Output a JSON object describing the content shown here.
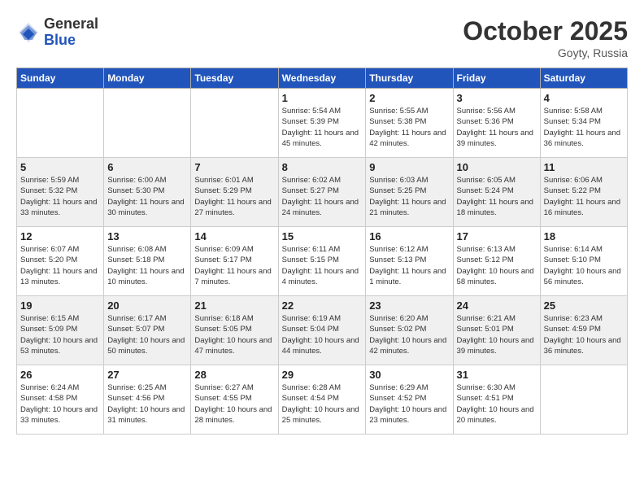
{
  "header": {
    "logo_general": "General",
    "logo_blue": "Blue",
    "month_title": "October 2025",
    "location": "Goyty, Russia"
  },
  "days_of_week": [
    "Sunday",
    "Monday",
    "Tuesday",
    "Wednesday",
    "Thursday",
    "Friday",
    "Saturday"
  ],
  "weeks": [
    [
      {
        "day": "",
        "info": ""
      },
      {
        "day": "",
        "info": ""
      },
      {
        "day": "",
        "info": ""
      },
      {
        "day": "1",
        "info": "Sunrise: 5:54 AM\nSunset: 5:39 PM\nDaylight: 11 hours and 45 minutes."
      },
      {
        "day": "2",
        "info": "Sunrise: 5:55 AM\nSunset: 5:38 PM\nDaylight: 11 hours and 42 minutes."
      },
      {
        "day": "3",
        "info": "Sunrise: 5:56 AM\nSunset: 5:36 PM\nDaylight: 11 hours and 39 minutes."
      },
      {
        "day": "4",
        "info": "Sunrise: 5:58 AM\nSunset: 5:34 PM\nDaylight: 11 hours and 36 minutes."
      }
    ],
    [
      {
        "day": "5",
        "info": "Sunrise: 5:59 AM\nSunset: 5:32 PM\nDaylight: 11 hours and 33 minutes."
      },
      {
        "day": "6",
        "info": "Sunrise: 6:00 AM\nSunset: 5:30 PM\nDaylight: 11 hours and 30 minutes."
      },
      {
        "day": "7",
        "info": "Sunrise: 6:01 AM\nSunset: 5:29 PM\nDaylight: 11 hours and 27 minutes."
      },
      {
        "day": "8",
        "info": "Sunrise: 6:02 AM\nSunset: 5:27 PM\nDaylight: 11 hours and 24 minutes."
      },
      {
        "day": "9",
        "info": "Sunrise: 6:03 AM\nSunset: 5:25 PM\nDaylight: 11 hours and 21 minutes."
      },
      {
        "day": "10",
        "info": "Sunrise: 6:05 AM\nSunset: 5:24 PM\nDaylight: 11 hours and 18 minutes."
      },
      {
        "day": "11",
        "info": "Sunrise: 6:06 AM\nSunset: 5:22 PM\nDaylight: 11 hours and 16 minutes."
      }
    ],
    [
      {
        "day": "12",
        "info": "Sunrise: 6:07 AM\nSunset: 5:20 PM\nDaylight: 11 hours and 13 minutes."
      },
      {
        "day": "13",
        "info": "Sunrise: 6:08 AM\nSunset: 5:18 PM\nDaylight: 11 hours and 10 minutes."
      },
      {
        "day": "14",
        "info": "Sunrise: 6:09 AM\nSunset: 5:17 PM\nDaylight: 11 hours and 7 minutes."
      },
      {
        "day": "15",
        "info": "Sunrise: 6:11 AM\nSunset: 5:15 PM\nDaylight: 11 hours and 4 minutes."
      },
      {
        "day": "16",
        "info": "Sunrise: 6:12 AM\nSunset: 5:13 PM\nDaylight: 11 hours and 1 minute."
      },
      {
        "day": "17",
        "info": "Sunrise: 6:13 AM\nSunset: 5:12 PM\nDaylight: 10 hours and 58 minutes."
      },
      {
        "day": "18",
        "info": "Sunrise: 6:14 AM\nSunset: 5:10 PM\nDaylight: 10 hours and 56 minutes."
      }
    ],
    [
      {
        "day": "19",
        "info": "Sunrise: 6:15 AM\nSunset: 5:09 PM\nDaylight: 10 hours and 53 minutes."
      },
      {
        "day": "20",
        "info": "Sunrise: 6:17 AM\nSunset: 5:07 PM\nDaylight: 10 hours and 50 minutes."
      },
      {
        "day": "21",
        "info": "Sunrise: 6:18 AM\nSunset: 5:05 PM\nDaylight: 10 hours and 47 minutes."
      },
      {
        "day": "22",
        "info": "Sunrise: 6:19 AM\nSunset: 5:04 PM\nDaylight: 10 hours and 44 minutes."
      },
      {
        "day": "23",
        "info": "Sunrise: 6:20 AM\nSunset: 5:02 PM\nDaylight: 10 hours and 42 minutes."
      },
      {
        "day": "24",
        "info": "Sunrise: 6:21 AM\nSunset: 5:01 PM\nDaylight: 10 hours and 39 minutes."
      },
      {
        "day": "25",
        "info": "Sunrise: 6:23 AM\nSunset: 4:59 PM\nDaylight: 10 hours and 36 minutes."
      }
    ],
    [
      {
        "day": "26",
        "info": "Sunrise: 6:24 AM\nSunset: 4:58 PM\nDaylight: 10 hours and 33 minutes."
      },
      {
        "day": "27",
        "info": "Sunrise: 6:25 AM\nSunset: 4:56 PM\nDaylight: 10 hours and 31 minutes."
      },
      {
        "day": "28",
        "info": "Sunrise: 6:27 AM\nSunset: 4:55 PM\nDaylight: 10 hours and 28 minutes."
      },
      {
        "day": "29",
        "info": "Sunrise: 6:28 AM\nSunset: 4:54 PM\nDaylight: 10 hours and 25 minutes."
      },
      {
        "day": "30",
        "info": "Sunrise: 6:29 AM\nSunset: 4:52 PM\nDaylight: 10 hours and 23 minutes."
      },
      {
        "day": "31",
        "info": "Sunrise: 6:30 AM\nSunset: 4:51 PM\nDaylight: 10 hours and 20 minutes."
      },
      {
        "day": "",
        "info": ""
      }
    ]
  ]
}
